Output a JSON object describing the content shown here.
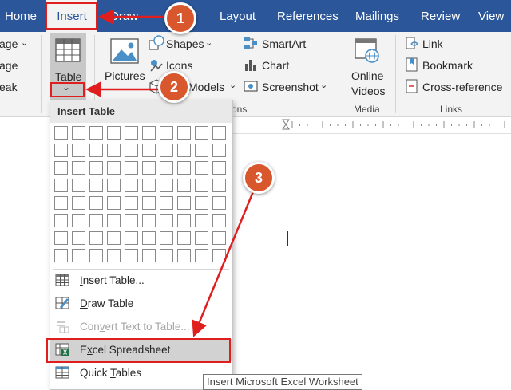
{
  "tabs": [
    {
      "label": "Home",
      "active": false
    },
    {
      "label": "Insert",
      "active": true
    },
    {
      "label": "Draw",
      "active": false
    },
    {
      "label": "Layout",
      "active": false
    },
    {
      "label": "References",
      "active": false
    },
    {
      "label": "Mailings",
      "active": false
    },
    {
      "label": "Review",
      "active": false
    },
    {
      "label": "View",
      "active": false
    }
  ],
  "ribbon": {
    "left_fragments": [
      "age",
      "age",
      "eak"
    ],
    "table_label": "Table",
    "pictures_label": "Pictures",
    "shapes_label": "Shapes",
    "icons_label": "Icons",
    "models_label": "Models",
    "smartart_label": "SmartArt",
    "chart_label": "Chart",
    "screenshot_label": "Screenshot",
    "online_videos_line1": "Online",
    "online_videos_line2": "Videos",
    "link_label": "Link",
    "bookmark_label": "Bookmark",
    "crossref_label": "Cross-reference",
    "group_media": "Media",
    "group_links": "Links",
    "group_partial": "ons"
  },
  "dropdown": {
    "title": "Insert Table",
    "grid_cols": 10,
    "grid_rows": 8,
    "items": [
      {
        "label": "Insert Table...",
        "icon": "insert-table-icon",
        "enabled": true,
        "highlighted": false
      },
      {
        "label": "Draw Table",
        "icon": "draw-table-icon",
        "enabled": true,
        "highlighted": false
      },
      {
        "label": "Convert Text to Table...",
        "icon": "convert-text-icon",
        "enabled": false,
        "highlighted": false
      },
      {
        "label": "Excel Spreadsheet",
        "icon": "excel-icon",
        "enabled": true,
        "highlighted": true
      },
      {
        "label": "Quick Tables",
        "icon": "quick-tables-icon",
        "enabled": true,
        "highlighted": false
      }
    ]
  },
  "tooltip": "Insert Microsoft Excel Worksheet",
  "steps": [
    "1",
    "2",
    "3"
  ],
  "colors": {
    "ribbon_blue": "#2b579a",
    "annotation_red": "#e01e1e",
    "badge_orange": "#d9572c"
  }
}
